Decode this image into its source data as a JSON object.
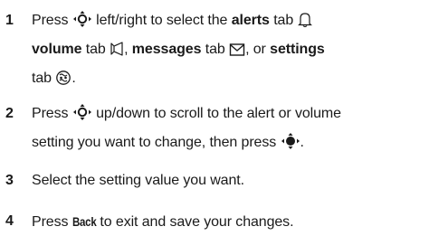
{
  "steps": [
    {
      "number": "1",
      "parts": {
        "a": "Press",
        "b": "left/right to select the",
        "alerts": "alerts",
        "c": "tab",
        "volume": "volume",
        "d": "tab",
        "messages": "messages",
        "e": "tab",
        "f": ", or",
        "settings": "settings",
        "g": "tab",
        "h": "."
      }
    },
    {
      "number": "2",
      "parts": {
        "a": "Press",
        "b": "up/down to scroll to the alert or volume",
        "c": "setting you want to change, then press",
        "d": "."
      }
    },
    {
      "number": "3",
      "text": "Select the setting value you want."
    },
    {
      "number": "4",
      "parts": {
        "a": "Press",
        "key": "Back",
        "b": "to exit and save your changes."
      }
    }
  ],
  "icons": {
    "nav": "nav-key-icon",
    "center": "center-key-icon",
    "alerts": "bell-icon",
    "volume": "speaker-icon",
    "messages": "envelope-icon",
    "settings": "settings-icon"
  }
}
